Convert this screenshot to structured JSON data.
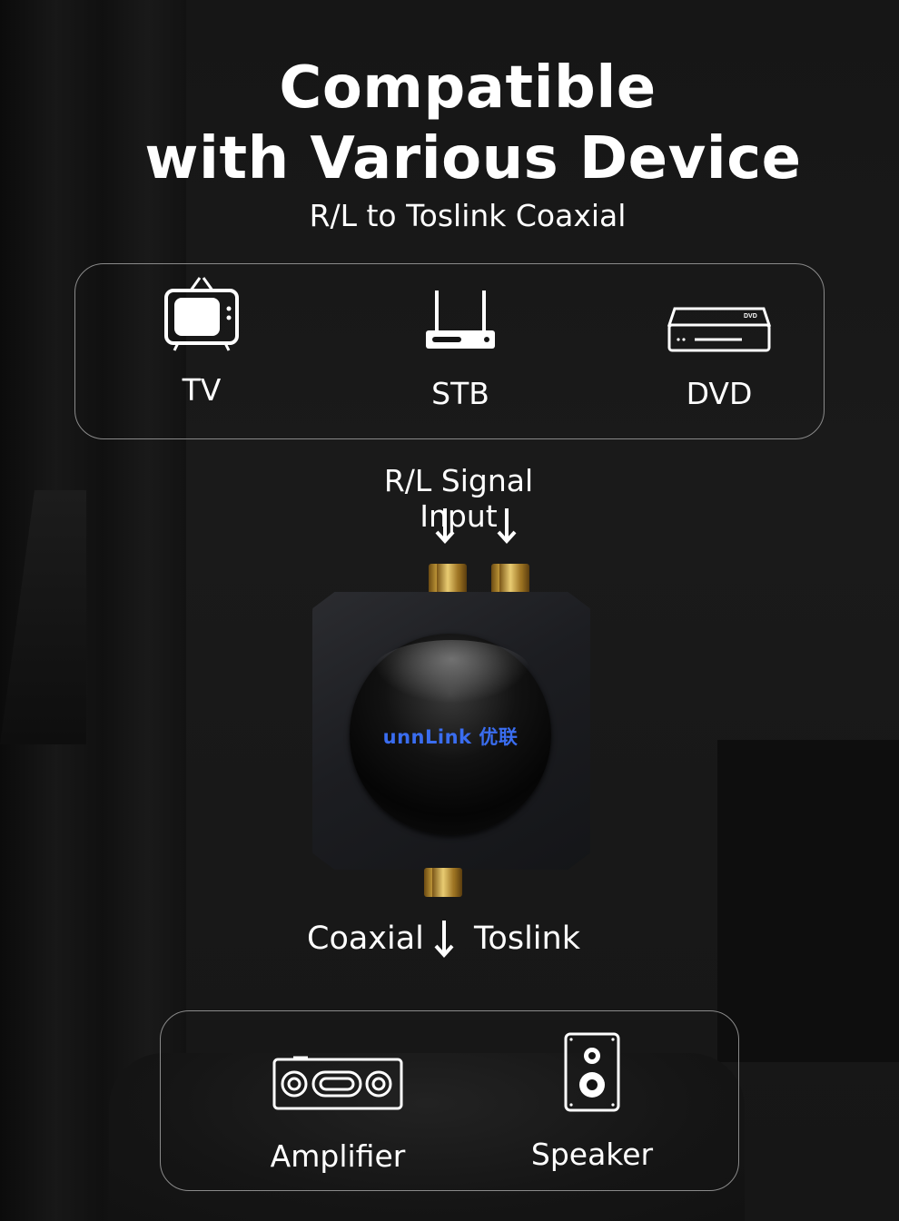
{
  "heading": {
    "line1": "Compatible",
    "line2": "with Various Device",
    "subtitle": "R/L to Toslink Coaxial"
  },
  "sources": [
    {
      "label": "TV",
      "icon": "tv-icon"
    },
    {
      "label": "STB",
      "icon": "set-top-box-icon"
    },
    {
      "label": "DVD",
      "icon": "dvd-player-icon"
    }
  ],
  "signal_input_label": "R/L Signal Input",
  "device": {
    "brand": "unnLink 优联"
  },
  "outputs": {
    "left_label": "Coaxial",
    "right_label": "Toslink"
  },
  "sinks": [
    {
      "label": "Amplifier",
      "icon": "amplifier-icon"
    },
    {
      "label": "Speaker",
      "icon": "speaker-icon"
    }
  ],
  "colors": {
    "background": "#141414",
    "text": "#ffffff",
    "panel_border": "#8a8a8a",
    "brand_blue": "#3a6df0",
    "gold_connector": "#caa13d"
  }
}
